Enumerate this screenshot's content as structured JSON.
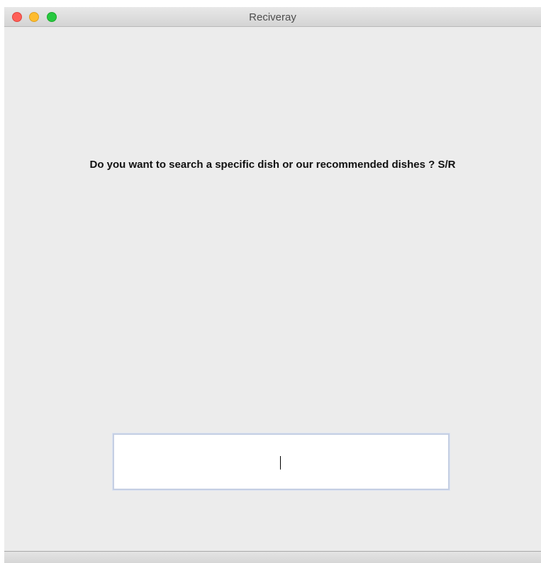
{
  "window": {
    "title": "Reciveray",
    "controls": {
      "close": "close-icon",
      "minimize": "minimize-icon",
      "zoom": "zoom-icon"
    }
  },
  "main": {
    "prompt": "Do you want to search a specific dish or our recommended dishes ? S/R",
    "input": {
      "value": "",
      "placeholder": ""
    }
  },
  "colors": {
    "close": "#fe5f57",
    "minimize": "#febc2e",
    "zoom": "#28c840",
    "background": "#ececec",
    "input_border": "#c5cfe3"
  }
}
